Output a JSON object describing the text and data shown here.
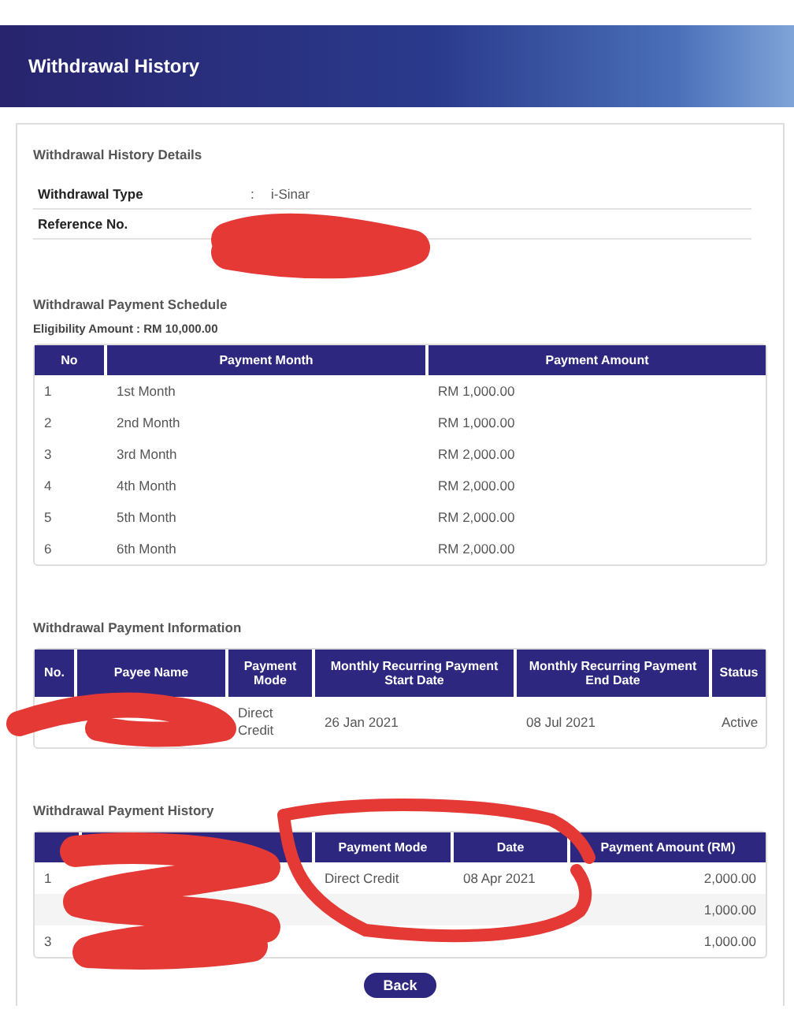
{
  "header": {
    "title": "Withdrawal History"
  },
  "details": {
    "title": "Withdrawal History Details",
    "rows": [
      {
        "label": "Withdrawal Type",
        "separator": ":",
        "value": "i-Sinar"
      },
      {
        "label": "Reference No.",
        "separator": null,
        "value": null
      }
    ]
  },
  "schedule": {
    "title": "Withdrawal Payment Schedule",
    "eligibility": "Eligibility Amount : RM 10,000.00",
    "columns": [
      "No",
      "Payment Month",
      "Payment Amount"
    ],
    "rows": [
      [
        "1",
        "1st Month",
        "RM 1,000.00"
      ],
      [
        "2",
        "2nd Month",
        "RM 1,000.00"
      ],
      [
        "3",
        "3rd Month",
        "RM 2,000.00"
      ],
      [
        "4",
        "4th Month",
        "RM 2,000.00"
      ],
      [
        "5",
        "5th Month",
        "RM 2,000.00"
      ],
      [
        "6",
        "6th Month",
        "RM 2,000.00"
      ]
    ]
  },
  "information": {
    "title": "Withdrawal Payment Information",
    "columns": [
      "No.",
      "Payee Name",
      "Payment Mode",
      "Monthly Recurring Payment Start Date",
      "Monthly Recurring Payment End Date",
      "Status"
    ],
    "rows": [
      [
        null,
        null,
        "Direct Credit",
        "26 Jan 2021",
        "08 Jul 2021",
        "Active"
      ]
    ]
  },
  "history": {
    "title": "Withdrawal Payment History",
    "columns": [
      null,
      null,
      "Payment Mode",
      "Date",
      "Payment Amount (RM)"
    ],
    "rows": [
      [
        "1",
        null,
        "Direct Credit",
        "08 Apr 2021",
        "2,000.00"
      ],
      [
        null,
        null,
        null,
        null,
        "1,000.00"
      ],
      [
        "3",
        null,
        null,
        null,
        "1,000.00"
      ]
    ]
  },
  "back_button": "Back"
}
